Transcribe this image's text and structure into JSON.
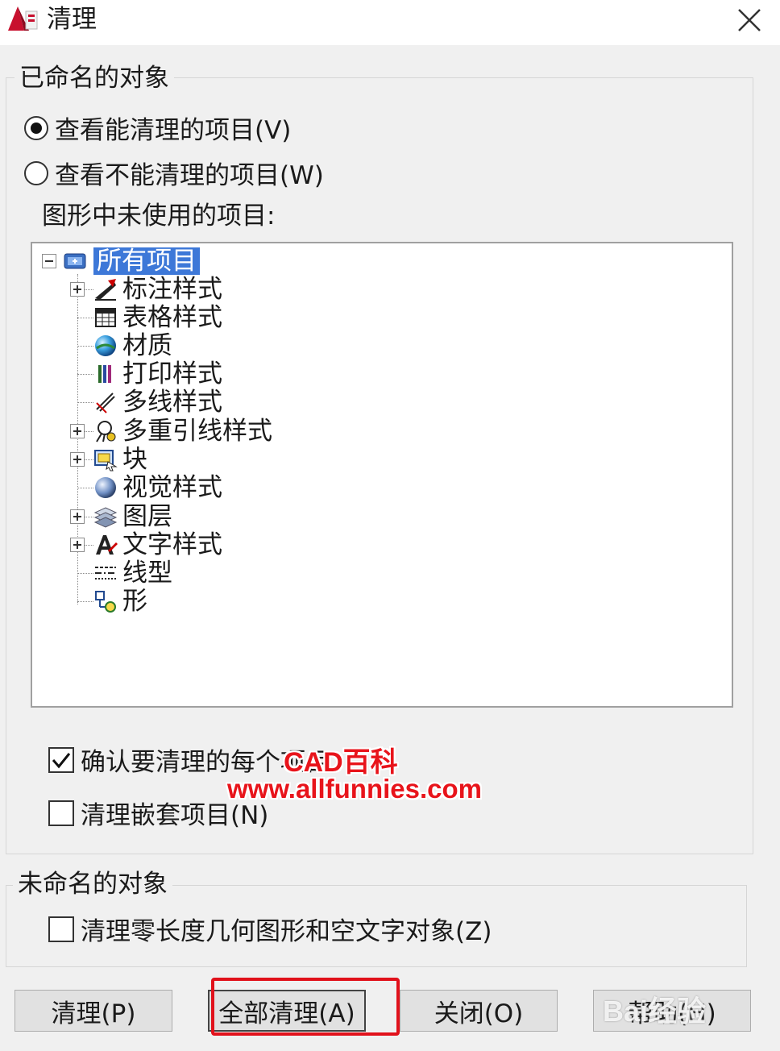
{
  "window": {
    "title": "清理"
  },
  "named_group": {
    "legend": "已命名的对象",
    "radio_purgeable": {
      "label": "查看能清理的项目(V)",
      "selected": true
    },
    "radio_nonpurgeable": {
      "label": "查看不能清理的项目(W)",
      "selected": false
    },
    "tree_label": "图形中未使用的项目:",
    "tree": {
      "root": "所有项目",
      "items": [
        {
          "label": "标注样式",
          "icon": "dimension-style-icon",
          "expandable": true
        },
        {
          "label": "表格样式",
          "icon": "table-style-icon",
          "expandable": false
        },
        {
          "label": "材质",
          "icon": "material-icon",
          "expandable": false
        },
        {
          "label": "打印样式",
          "icon": "plot-style-icon",
          "expandable": false
        },
        {
          "label": "多线样式",
          "icon": "multiline-style-icon",
          "expandable": false
        },
        {
          "label": "多重引线样式",
          "icon": "multileader-style-icon",
          "expandable": true
        },
        {
          "label": "块",
          "icon": "block-icon",
          "expandable": true
        },
        {
          "label": "视觉样式",
          "icon": "visual-style-icon",
          "expandable": false
        },
        {
          "label": "图层",
          "icon": "layer-icon",
          "expandable": true
        },
        {
          "label": "文字样式",
          "icon": "text-style-icon",
          "expandable": true
        },
        {
          "label": "线型",
          "icon": "linetype-icon",
          "expandable": false
        },
        {
          "label": "形",
          "icon": "shape-icon",
          "expandable": false
        }
      ]
    },
    "cb_confirm": {
      "label": "确认要清理的每个项目",
      "checked": true
    },
    "cb_nested": {
      "label": "清理嵌套项目(N)",
      "checked": false
    }
  },
  "unnamed_group": {
    "legend": "未命名的对象",
    "cb_zero": {
      "label": "清理零长度几何图形和空文字对象(Z)",
      "checked": false
    }
  },
  "buttons": {
    "purge": "清理(P)",
    "purge_all": "全部清理(A)",
    "close": "关闭(O)",
    "help": "帮助(H)"
  },
  "watermark": {
    "line1": "CAD百科",
    "line2": "www.allfunnies.com",
    "baidu": "Bai经验"
  },
  "colors": {
    "selection": "#3d78d8",
    "highlight": "#e1111b",
    "watermark": "#e8141b"
  }
}
